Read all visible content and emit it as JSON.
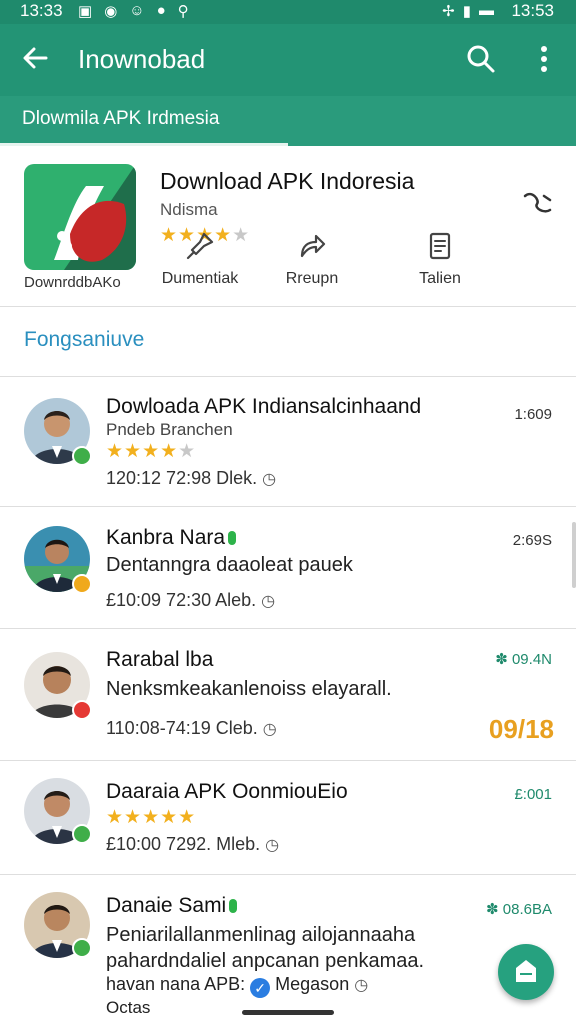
{
  "status_bar": {
    "time_left": "13:33",
    "time_right": "13:53"
  },
  "app_bar": {
    "title": "Inownobad"
  },
  "sub_bar": {
    "label": "Dlowmila APK Irdmesia"
  },
  "app_card": {
    "title": "Download APK Indoresia",
    "subtitle": "Ndisma",
    "rating": 4,
    "icon_label": "DownrddbAKo",
    "actions": [
      {
        "label": "Dumentiak",
        "icon": "pin-icon"
      },
      {
        "label": "Rreupn",
        "icon": "share-arrow-icon"
      },
      {
        "label": "Talien",
        "icon": "document-icon"
      }
    ]
  },
  "section_title": "Fongsaniuve",
  "list": [
    {
      "name": "Dowloada APK Indiansalcinhaand",
      "line2": "Pndeb Branchen",
      "rating": 4,
      "meta": "120:12 72:98 Dlek.",
      "right": "1:609",
      "badge_color": "#3fae49"
    },
    {
      "name": "Kanbra Nara",
      "line2": "Dentanngra daaoleat pauek",
      "meta": "£10:09 72:30 Aleb.",
      "right": "2:69S",
      "badge_color": "#f0a91c"
    },
    {
      "name": "Rarabal lba",
      "line2": "Nenksmkeakanlenoiss elayarall.",
      "meta": "110:08-74:19 Cleb.",
      "right": "09.4N",
      "big": "09/18",
      "badge_color": "#e53935"
    },
    {
      "name": "Daaraia APK OonmiouEio",
      "rating": 5,
      "meta": "£10:00 7292. Mleb.",
      "right": "£:001",
      "badge_color": "#3fae49"
    },
    {
      "name": "Danaie Sami",
      "line2": "Peniarilallanmenlinag ailojannaaha",
      "line3": "pahardndaliel anpcanan penkamaa.",
      "line4": "havan nana APB:",
      "line4b": "Megason",
      "line5": "Octas",
      "right": "08.6BA",
      "badge_color": "#3fae49"
    }
  ],
  "colors": {
    "accent": "#239475",
    "star": "#f2b01e",
    "link": "#2a8fbf"
  }
}
